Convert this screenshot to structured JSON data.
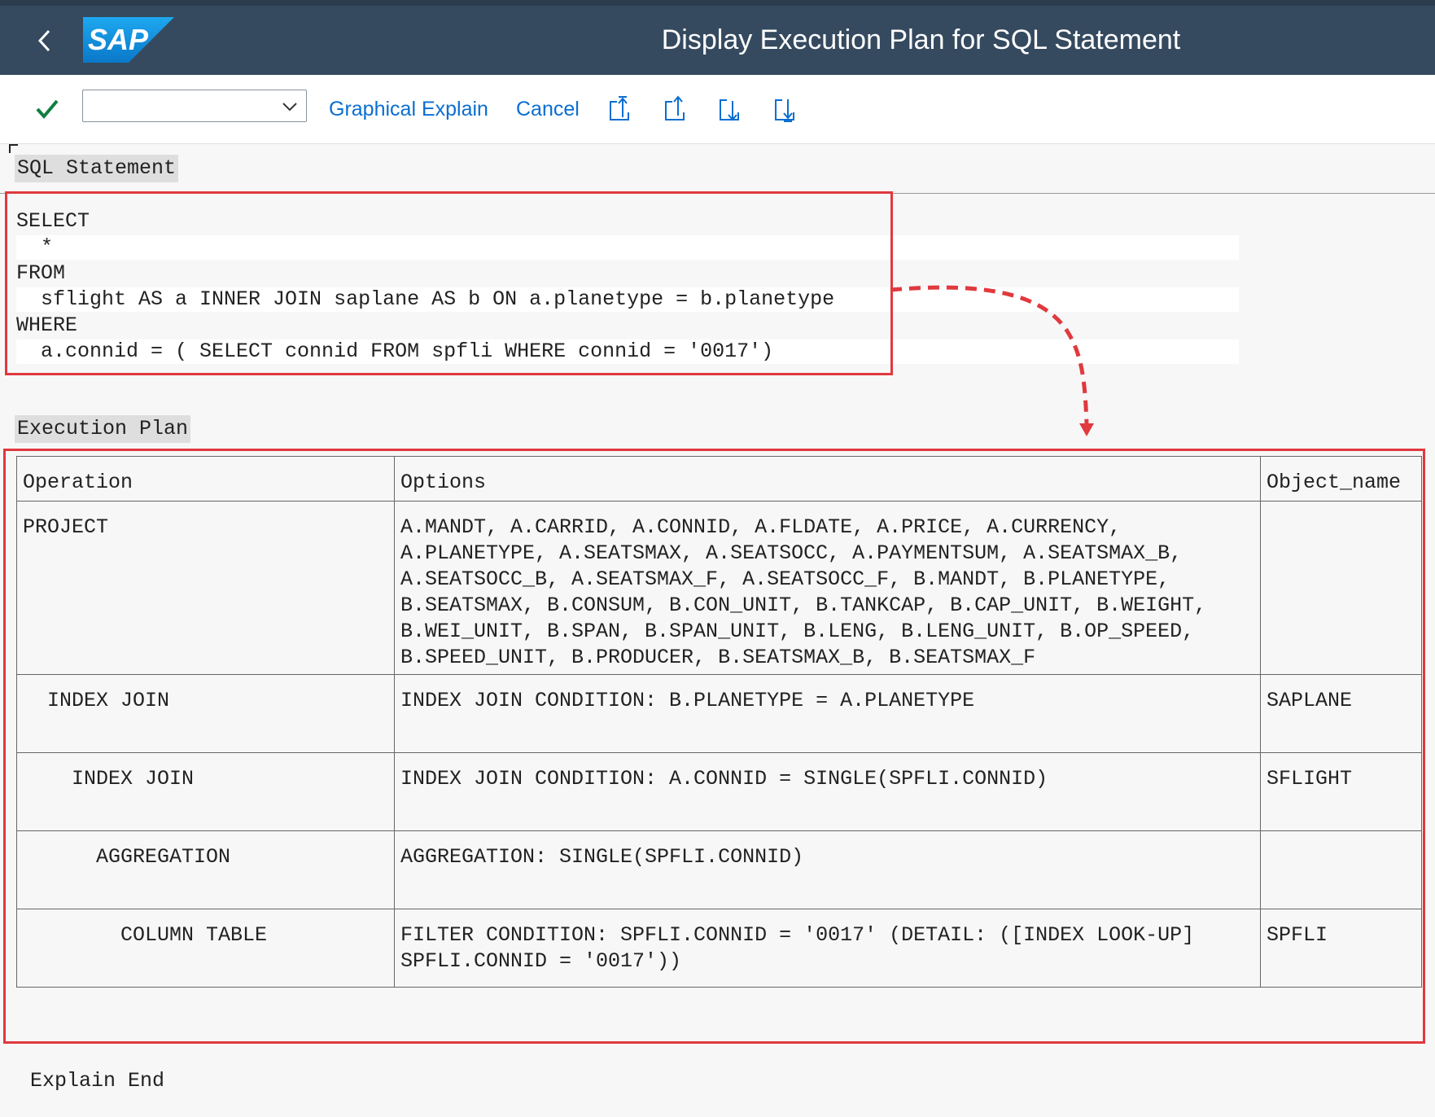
{
  "header": {
    "title": "Display Execution Plan for SQL Statement",
    "logo_text": "SAP"
  },
  "toolbar": {
    "command_field_value": "",
    "graphical_explain_label": "Graphical Explain",
    "cancel_label": "Cancel",
    "icons": [
      "check-icon",
      "first-page-icon",
      "previous-page-icon",
      "next-page-icon",
      "last-page-icon"
    ]
  },
  "sql_section": {
    "header": "SQL Statement",
    "lines": [
      "SELECT",
      "  *",
      "FROM",
      "  sflight AS a INNER JOIN saplane AS b ON a.planetype = b.planetype",
      "WHERE",
      "  a.connid = ( SELECT connid FROM spfli WHERE connid = '0017')"
    ]
  },
  "plan_section": {
    "header": "Execution Plan",
    "columns": [
      "Operation",
      "Options",
      "Object_name"
    ],
    "rows": [
      {
        "operation": "PROJECT",
        "options": "A.MANDT, A.CARRID, A.CONNID, A.FLDATE, A.PRICE, A.CURRENCY,\nA.PLANETYPE, A.SEATSMAX, A.SEATSOCC, A.PAYMENTSUM, A.SEATSMAX_B,\nA.SEATSOCC_B, A.SEATSMAX_F, A.SEATSOCC_F, B.MANDT, B.PLANETYPE,\nB.SEATSMAX, B.CONSUM, B.CON_UNIT, B.TANKCAP, B.CAP_UNIT, B.WEIGHT,\nB.WEI_UNIT, B.SPAN, B.SPAN_UNIT, B.LENG, B.LENG_UNIT, B.OP_SPEED,\nB.SPEED_UNIT, B.PRODUCER, B.SEATSMAX_B, B.SEATSMAX_F",
        "object_name": ""
      },
      {
        "operation": "  INDEX JOIN",
        "options": "INDEX JOIN CONDITION: B.PLANETYPE = A.PLANETYPE",
        "object_name": "SAPLANE"
      },
      {
        "operation": "    INDEX JOIN",
        "options": "INDEX JOIN CONDITION: A.CONNID = SINGLE(SPFLI.CONNID)",
        "object_name": "SFLIGHT"
      },
      {
        "operation": "      AGGREGATION",
        "options": "AGGREGATION: SINGLE(SPFLI.CONNID)",
        "object_name": ""
      },
      {
        "operation": "        COLUMN TABLE",
        "options": "FILTER CONDITION: SPFLI.CONNID = '0017' (DETAIL: ([INDEX LOOK-UP]\nSPFLI.CONNID = '0017'))",
        "object_name": "SPFLI"
      }
    ]
  },
  "footer_text": "Explain End",
  "colors": {
    "shell_header": "#354a5f",
    "accent_blue": "#0a6ed1",
    "check_green": "#107e3e",
    "annotation_red": "#e0393e"
  }
}
